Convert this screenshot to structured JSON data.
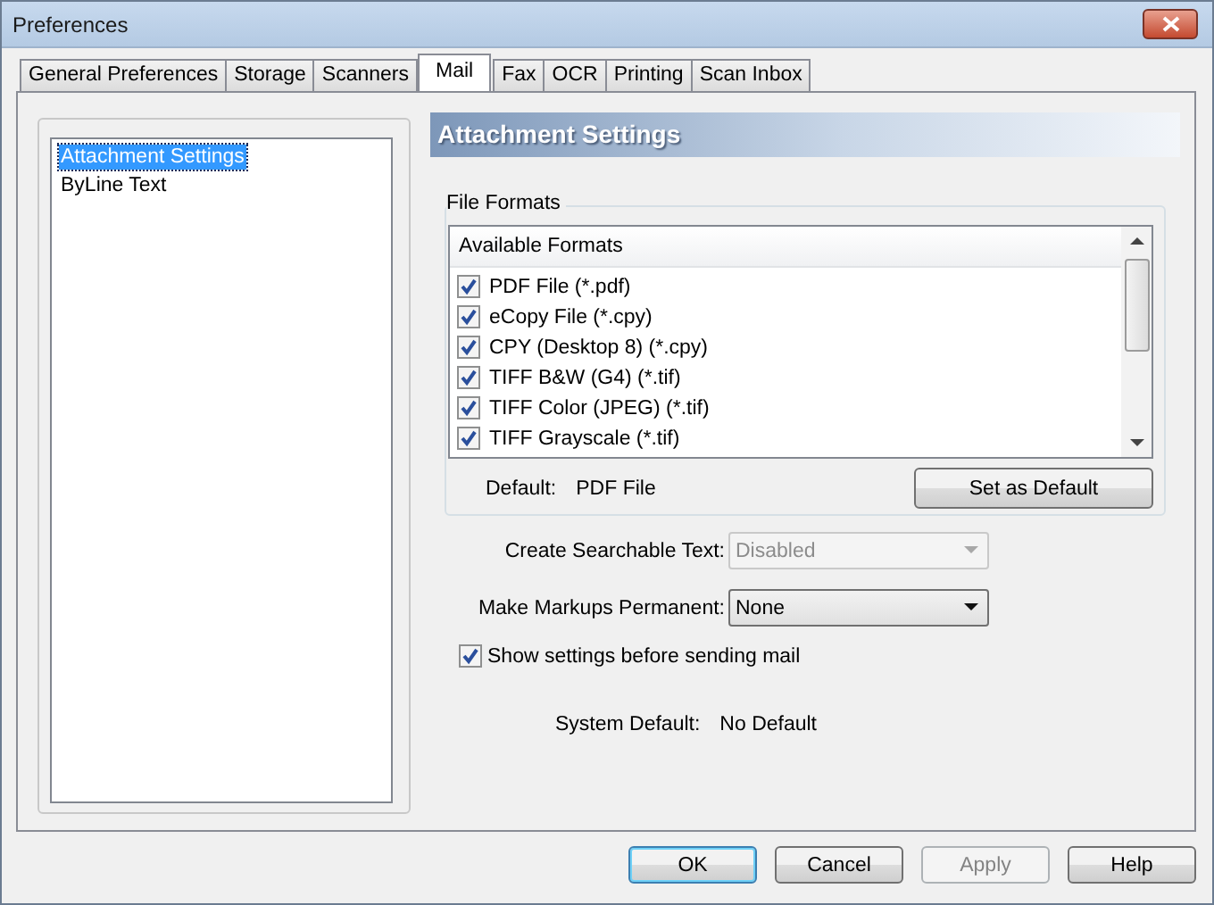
{
  "window": {
    "title": "Preferences"
  },
  "tabs": [
    {
      "label": "General Preferences",
      "selected": false
    },
    {
      "label": "Storage",
      "selected": false
    },
    {
      "label": "Scanners",
      "selected": false
    },
    {
      "label": "Mail",
      "selected": true
    },
    {
      "label": "Fax",
      "selected": false
    },
    {
      "label": "OCR",
      "selected": false
    },
    {
      "label": "Printing",
      "selected": false
    },
    {
      "label": "Scan Inbox",
      "selected": false
    }
  ],
  "sidebar": {
    "items": [
      {
        "label": "Attachment Settings",
        "selected": true
      },
      {
        "label": "ByLine Text",
        "selected": false
      }
    ]
  },
  "section_title": "Attachment Settings",
  "file_formats": {
    "title": "File Formats",
    "column": "Available Formats",
    "items": [
      {
        "label": "PDF File (*.pdf)",
        "checked": true
      },
      {
        "label": "eCopy File (*.cpy)",
        "checked": true
      },
      {
        "label": "CPY (Desktop 8) (*.cpy)",
        "checked": true
      },
      {
        "label": "TIFF B&W (G4) (*.tif)",
        "checked": true
      },
      {
        "label": "TIFF Color (JPEG) (*.tif)",
        "checked": true
      },
      {
        "label": "TIFF Grayscale (*.tif)",
        "checked": true
      }
    ],
    "default_label": "Default:",
    "default_value": "PDF File",
    "set_default_button": "Set as Default"
  },
  "fields": [
    {
      "label": "Create Searchable Text:",
      "value": "Disabled",
      "disabled": true
    },
    {
      "label": "Make Markups Permanent:",
      "value": "None",
      "disabled": false
    }
  ],
  "show_settings": {
    "label": "Show settings before sending mail",
    "checked": true
  },
  "system_default": {
    "label": "System Default:",
    "value": "No Default"
  },
  "buttons": [
    {
      "label": "OK",
      "default": true,
      "disabled": false
    },
    {
      "label": "Cancel",
      "default": false,
      "disabled": false
    },
    {
      "label": "Apply",
      "default": false,
      "disabled": true
    },
    {
      "label": "Help",
      "default": false,
      "disabled": false
    }
  ]
}
